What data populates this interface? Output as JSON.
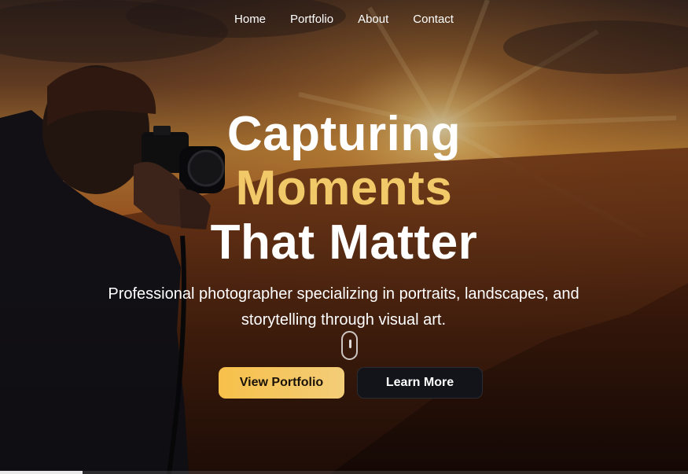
{
  "nav": {
    "items": [
      {
        "label": "Home"
      },
      {
        "label": "Portfolio"
      },
      {
        "label": "About"
      },
      {
        "label": "Contact"
      }
    ]
  },
  "hero": {
    "headline_line1": "Capturing",
    "headline_line2": "Moments",
    "headline_line3": "That Matter",
    "subtitle": "Professional photographer specializing in portraits, landscapes, and storytelling through visual art.",
    "primary_button": "View Portfolio",
    "secondary_button": "Learn More",
    "accent_color": "#f2c968"
  },
  "scroll_indicator": {
    "icon": "mouse-scroll-icon"
  },
  "page_progress": {
    "fraction": 0.12
  }
}
